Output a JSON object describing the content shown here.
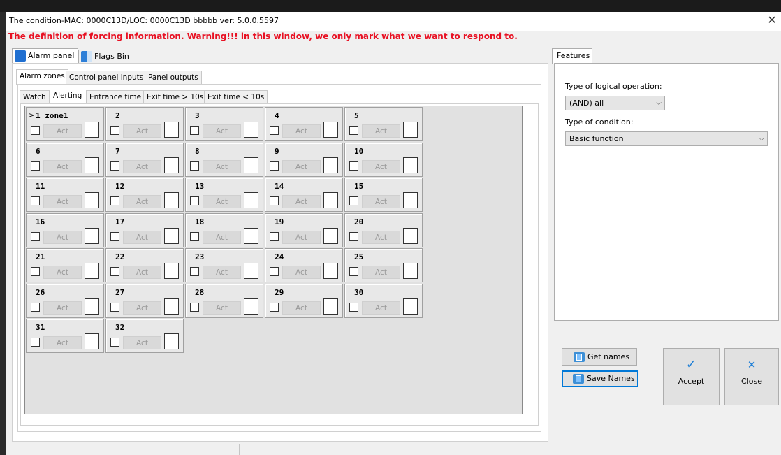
{
  "window": {
    "title": "The condition-MAC: 0000C13D/LOC: 0000C13D bbbbb ver: 5.0.0.5597",
    "close_glyph": "✕"
  },
  "warning_text": "The definition of forcing information. Warning!!! in this window, we only mark what we want to respond to.",
  "tabs": [
    {
      "label": "Alarm panel",
      "icon": "alarm-bell-icon",
      "active": true
    },
    {
      "label": "Flags Bin",
      "icon": "flags-icon",
      "active": false
    }
  ],
  "subtabs": [
    {
      "label": "Alarm zones",
      "active": true
    },
    {
      "label": "Control panel inputs",
      "active": false
    },
    {
      "label": "Panel outputs",
      "active": false
    }
  ],
  "state_tabs": [
    {
      "label": "Watch",
      "active": false
    },
    {
      "label": "Alerting",
      "active": true
    },
    {
      "label": "Entrance time",
      "active": false
    },
    {
      "label": "Exit time > 10s",
      "active": false
    },
    {
      "label": "Exit time < 10s",
      "active": false
    }
  ],
  "zones": {
    "act_label": "Act",
    "selected_marker": ">",
    "items": [
      "1 zone1",
      "2",
      "3",
      "4",
      "5",
      "6",
      "7",
      "8",
      "9",
      "10",
      "11",
      "12",
      "13",
      "14",
      "15",
      "16",
      "17",
      "18",
      "19",
      "20",
      "21",
      "22",
      "23",
      "24",
      "25",
      "26",
      "27",
      "28",
      "29",
      "30",
      "31",
      "32"
    ]
  },
  "features": {
    "tab_label": "Features",
    "logical_label": "Type of logical operation:",
    "logical_value": "(AND) all",
    "condition_label": "Type of condition:",
    "condition_value": "Basic function"
  },
  "buttons": {
    "get_names": "Get names",
    "save_names": "Save Names",
    "accept": "Accept",
    "accept_glyph": "✓",
    "close": "Close",
    "close_glyph": "✕"
  },
  "colors": {
    "warning": "#e81123",
    "accent": "#1f7fd6"
  }
}
